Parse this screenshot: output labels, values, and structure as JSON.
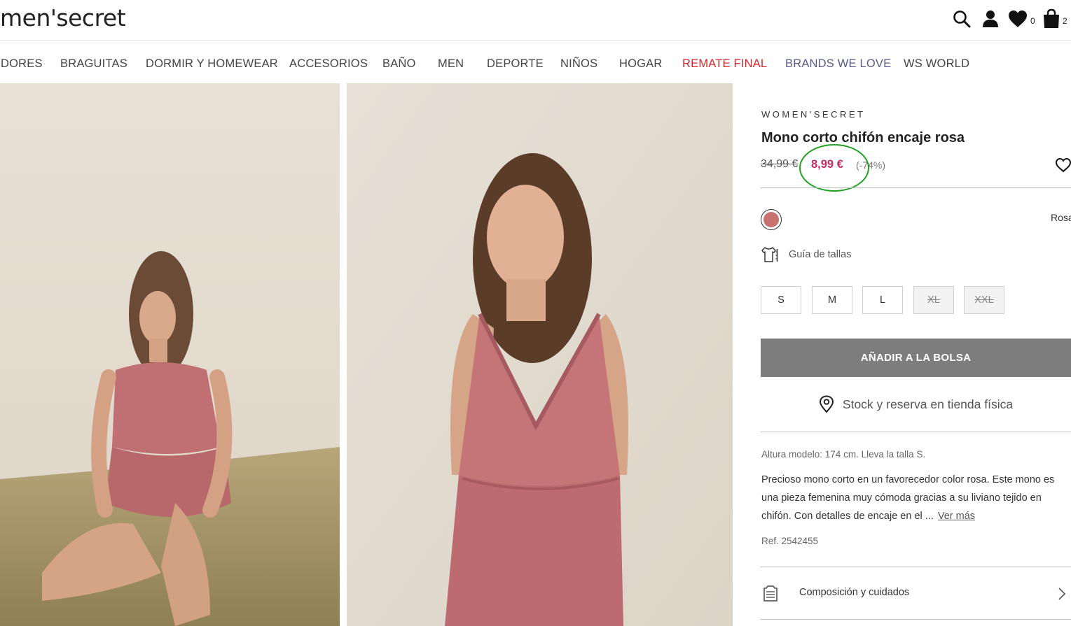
{
  "header": {
    "logo": "men'secret",
    "wishlist_count": "0",
    "bag_count": "2"
  },
  "nav": {
    "items": [
      {
        "label": "DORES",
        "color": "#444444"
      },
      {
        "label": "BRAGUITAS",
        "color": "#444444"
      },
      {
        "label": "DORMIR Y HOMEWEAR",
        "color": "#444444"
      },
      {
        "label": "ACCESORIOS",
        "color": "#444444"
      },
      {
        "label": "BAÑO",
        "color": "#444444"
      },
      {
        "label": "MEN",
        "color": "#444444"
      },
      {
        "label": "DEPORTE",
        "color": "#444444"
      },
      {
        "label": "NIÑOS",
        "color": "#444444"
      },
      {
        "label": "HOGAR",
        "color": "#444444"
      },
      {
        "label": "REMATE FINAL",
        "color": "#d9262d"
      },
      {
        "label": "BRANDS WE LOVE",
        "color": "#5a5a8a"
      },
      {
        "label": "WS WORLD",
        "color": "#444444"
      }
    ]
  },
  "product": {
    "brand": "WOMEN'SECRET",
    "title": "Mono corto chifón encaje rosa",
    "old_price": "34,99 €",
    "new_price": "8,99 €",
    "discount": "(-74%)",
    "color_name": "Rosa",
    "swatch_color": "#c8716f",
    "size_guide": "Guía de tallas",
    "sizes": [
      {
        "label": "S",
        "available": true
      },
      {
        "label": "M",
        "available": true
      },
      {
        "label": "L",
        "available": true
      },
      {
        "label": "XL",
        "available": false
      },
      {
        "label": "XXL",
        "available": false
      }
    ],
    "add_to_bag": "AÑADIR A LA BOLSA",
    "stock": "Stock y reserva en tienda física",
    "model_info": "Altura modelo: 174 cm.  Lleva la talla S.",
    "description": "Precioso mono corto en un favorecedor color rosa. Este mono es una pieza femenina muy cómoda gracias a su liviano tejido en chifón. Con detalles de encaje en el ...",
    "read_more": "Ver más",
    "ref": "Ref. 2542455",
    "composition": "Composición y cuidados"
  },
  "colors": {
    "sale_price": "#c0305e",
    "annotation": "#22a022",
    "button_bg": "#7d7d7d"
  }
}
